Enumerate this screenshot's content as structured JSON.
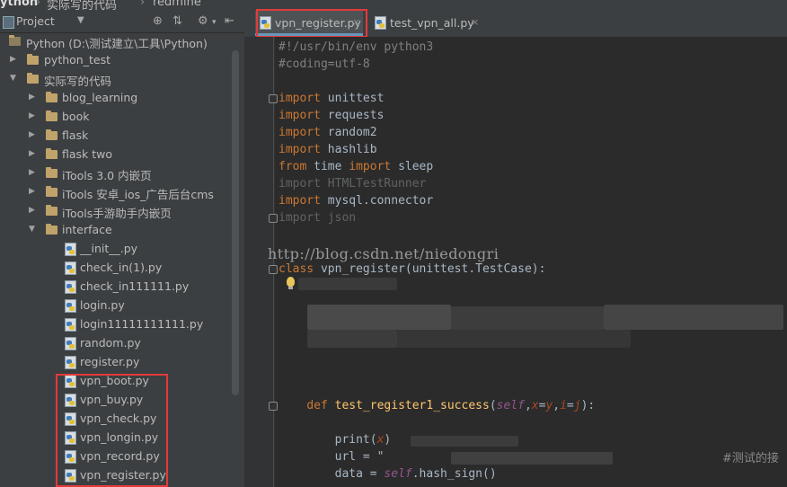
{
  "breadcrumb": {
    "root": "ython",
    "folder": "实际写的代码",
    "file": "redmine"
  },
  "project_panel": {
    "title": "Project",
    "root_label": "Python (D:\\测试建立\\工具\\Python)",
    "items": [
      {
        "label": "python_test",
        "type": "folder"
      },
      {
        "label": "实际写的代码",
        "type": "folder"
      },
      {
        "label": "blog_learning",
        "type": "folder"
      },
      {
        "label": "book",
        "type": "folder"
      },
      {
        "label": "flask",
        "type": "folder"
      },
      {
        "label": "flask two",
        "type": "folder"
      },
      {
        "label": "iTools 3.0 内嵌页",
        "type": "folder"
      },
      {
        "label": "iTools 安卓_ios_广告后台cms",
        "type": "folder"
      },
      {
        "label": "iTools手游助手内嵌页",
        "type": "folder"
      },
      {
        "label": "interface",
        "type": "folder"
      },
      {
        "label": "__init__.py",
        "type": "py"
      },
      {
        "label": "check_in(1).py",
        "type": "py"
      },
      {
        "label": "check_in111111.py",
        "type": "py"
      },
      {
        "label": "login.py",
        "type": "py"
      },
      {
        "label": "login11111111111.py",
        "type": "py"
      },
      {
        "label": "random.py",
        "type": "py"
      },
      {
        "label": "register.py",
        "type": "py"
      },
      {
        "label": "vpn_boot.py",
        "type": "py"
      },
      {
        "label": "vpn_buy.py",
        "type": "py"
      },
      {
        "label": "vpn_check.py",
        "type": "py"
      },
      {
        "label": "vpn_longin.py",
        "type": "py"
      },
      {
        "label": "vpn_record.py",
        "type": "py"
      },
      {
        "label": "vpn_register.py",
        "type": "py"
      }
    ]
  },
  "tabs": [
    {
      "label": "vpn_register.py",
      "close": "×"
    },
    {
      "label": "test_vpn_all.py",
      "close": "×"
    }
  ],
  "code": {
    "shebang": "#!/usr/bin/env python3",
    "coding": "#coding=utf-8",
    "imports": [
      {
        "kw": "import",
        "mod": "unittest"
      },
      {
        "kw": "import",
        "mod": "requests"
      },
      {
        "kw": "import",
        "mod": "random2"
      },
      {
        "kw": "import",
        "mod": "hashlib"
      }
    ],
    "from_kw": "from",
    "from_mod": "time",
    "from_import": "import",
    "from_name": "sleep",
    "dim1": "import HTMLTestRunner",
    "mysql_kw": "import",
    "mysql_mod": "mysql.connector",
    "dim2": "import json",
    "class_kw": "class",
    "class_decl": "vpn_register(unittest.TestCase):",
    "def_kw": "def",
    "def_name": "test_register1_success",
    "self_word": "self",
    "x_param": "x",
    "eq1": "=",
    "y_param": "y",
    "i_param": "i",
    "eq2": "=",
    "j_param": "j",
    "print_word": "print",
    "print_arg": "x",
    "url_line": "url = \"",
    "data_line1": "data = ",
    "data_self": "self",
    "data_line2": ".hash_sign()"
  },
  "watermark": "http://blog.csdn.net/niedongri",
  "trailing_comment": "#测试的接"
}
